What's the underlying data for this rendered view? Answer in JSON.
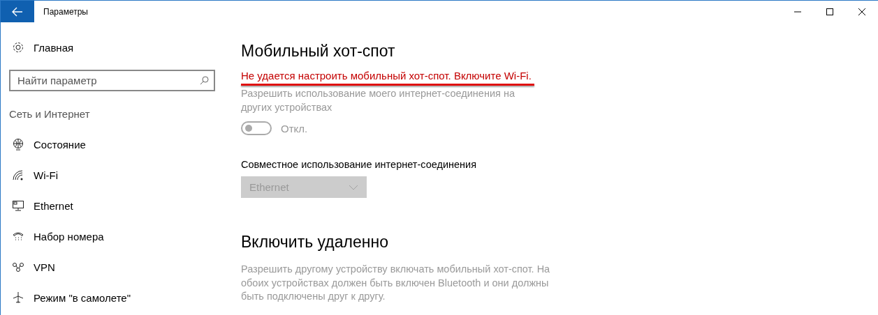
{
  "window": {
    "title": "Параметры"
  },
  "sidebar": {
    "home": "Главная",
    "search": {
      "placeholder": "Найти параметр"
    },
    "section": "Сеть и Интернет",
    "items": [
      {
        "label": "Состояние",
        "kind": "status",
        "selected": false
      },
      {
        "label": "Wi-Fi",
        "kind": "wifi",
        "selected": false
      },
      {
        "label": "Ethernet",
        "kind": "ethernet",
        "selected": false
      },
      {
        "label": "Набор номера",
        "kind": "dialup",
        "selected": false
      },
      {
        "label": "VPN",
        "kind": "vpn",
        "selected": false
      },
      {
        "label": "Режим \"в самолете\"",
        "kind": "airplane",
        "selected": false
      }
    ]
  },
  "hotspot": {
    "title": "Мобильный хот-спот",
    "error": "Не удается настроить мобильный хот-спот. Включите Wi-Fi.",
    "error_underlined": true,
    "description": "Разрешить использование моего интернет-соединения на других устройствах",
    "toggle": {
      "on": false,
      "disabled": true,
      "label": "Откл."
    },
    "share_label": "Совместное использование интернет-соединения",
    "share_dropdown": {
      "value": "Ethernet",
      "disabled": true
    }
  },
  "remote": {
    "title": "Включить удаленно",
    "description": "Разрешить другому устройству включать мобильный хот-спот. На обоих устройствах должен быть включен Bluetooth и они должны быть подключены друг к другу."
  }
}
